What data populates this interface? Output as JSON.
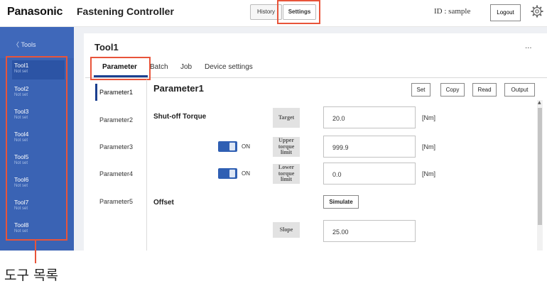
{
  "header": {
    "brand": "Panasonic",
    "app_title": "Fastening Controller",
    "history_label": "History",
    "settings_label": "Settings",
    "user_id": "ID : sample",
    "logout_label": "Logout"
  },
  "sidebar": {
    "back_label": "〈  Tools",
    "items": [
      {
        "name": "Tool1",
        "status": "Not set"
      },
      {
        "name": "Tool2",
        "status": "Not set"
      },
      {
        "name": "Tool3",
        "status": "Not set"
      },
      {
        "name": "Tool4",
        "status": "Not set"
      },
      {
        "name": "Tool5",
        "status": "Not set"
      },
      {
        "name": "Tool6",
        "status": "Not set"
      },
      {
        "name": "Tool7",
        "status": "Not set"
      },
      {
        "name": "Tool8",
        "status": "Not set"
      }
    ]
  },
  "annotation": {
    "caption": "도구 목록",
    "highlight_color": "#e8543a"
  },
  "main": {
    "tool_title": "Tool1",
    "more": "...",
    "tabs": [
      "Parameter",
      "Batch",
      "Job",
      "Device settings"
    ],
    "parameters": [
      "Parameter1",
      "Parameter2",
      "Parameter3",
      "Parameter4",
      "Parameter5"
    ],
    "panel_title": "Parameter1",
    "actions": {
      "set": "Set",
      "copy": "Copy",
      "read": "Read",
      "output": "Output"
    },
    "shutoff_section": "Shut-off Torque",
    "offset_section": "Offset",
    "toggles": {
      "upper": "ON",
      "lower": "ON"
    },
    "fields": {
      "target": {
        "label": "Target",
        "value": "20.0",
        "unit": "[Nm]"
      },
      "upper": {
        "label": "Upper torque limit",
        "value": "999.9",
        "unit": "[Nm]"
      },
      "lower": {
        "label": "Lower torque limit",
        "value": "0.0",
        "unit": "[Nm]"
      },
      "slope": {
        "label": "Slope",
        "value": "25.00"
      }
    },
    "simulate_label": "Simulate"
  },
  "colors": {
    "sidebar": "#3a63b4",
    "accent": "#1b3f8f",
    "toggle_on": "#2f5fb3"
  }
}
